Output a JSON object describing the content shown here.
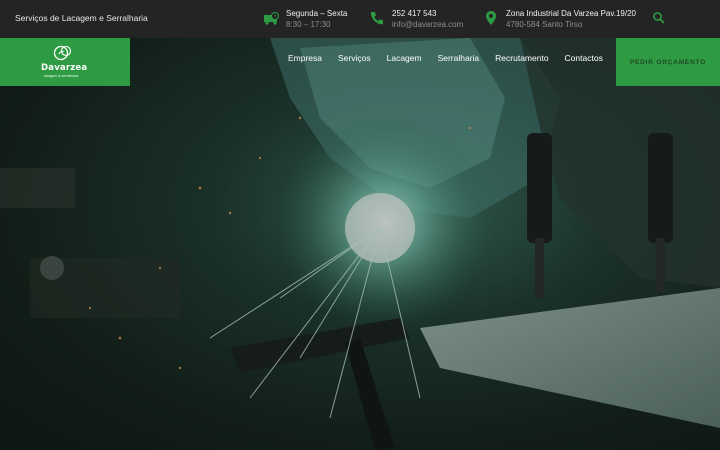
{
  "topbar": {
    "tagline": "Serviços de Lacagem e Serralharia",
    "hours": {
      "icon": "truck-clock-icon",
      "line1": "Segunda – Sexta",
      "line2": "8:30 – 17:30"
    },
    "contact": {
      "icon": "phone-icon",
      "line1": "252 417 543",
      "line2": "info@davarzea.com"
    },
    "address": {
      "icon": "location-pin-icon",
      "line1": "Zona Industrial Da Varzea Pav.19/20",
      "line2": "4780-584 Santo Tirso"
    },
    "search_icon": "search-icon"
  },
  "nav": {
    "logo": {
      "brand": "Davarzea",
      "sub": "lacagem & serralharia"
    },
    "items": [
      {
        "label": "Empresa"
      },
      {
        "label": "Serviços"
      },
      {
        "label": "Lacagem"
      },
      {
        "label": "Serralharia"
      },
      {
        "label": "Recrutamento"
      },
      {
        "label": "Contactos"
      }
    ],
    "cta": "PEDIR ORÇAMENTO"
  },
  "colors": {
    "accent": "#2e9b43",
    "topbar_bg": "#242424",
    "icon": "#2e9b43"
  }
}
